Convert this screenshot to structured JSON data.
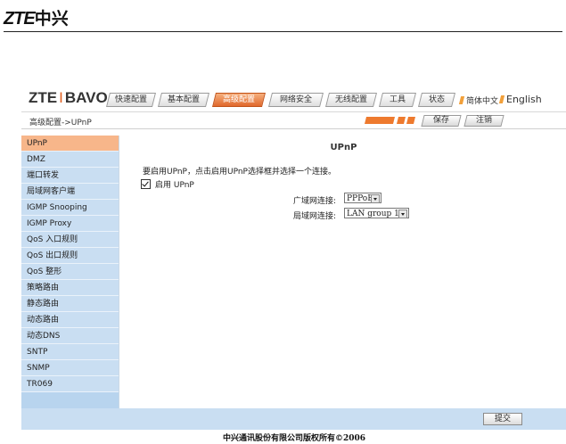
{
  "document": {
    "logo_latin": "ZTE",
    "logo_cjk": "中兴"
  },
  "header": {
    "brand_left": "ZTE",
    "brand_sep": "I",
    "brand_right": "BAVO",
    "tabs": [
      {
        "label": "快速配置",
        "active": false
      },
      {
        "label": "基本配置",
        "active": false
      },
      {
        "label": "高级配置",
        "active": true
      },
      {
        "label": "网络安全",
        "active": false
      },
      {
        "label": "无线配置",
        "active": false
      },
      {
        "label": "工具",
        "active": false
      },
      {
        "label": "状态",
        "active": false
      }
    ],
    "lang_cn": "简体中文",
    "lang_en": "English"
  },
  "subbar": {
    "breadcrumb": "高级配置->UPnP",
    "save_label": "保存",
    "logout_label": "注销"
  },
  "sidebar": {
    "items": [
      {
        "label": "UPnP",
        "active": true
      },
      {
        "label": "DMZ"
      },
      {
        "label": "端口转发"
      },
      {
        "label": "局域网客户端"
      },
      {
        "label": "IGMP Snooping"
      },
      {
        "label": "IGMP Proxy"
      },
      {
        "label": "QoS 入口规则"
      },
      {
        "label": "QoS 出口规则"
      },
      {
        "label": "QoS 整形"
      },
      {
        "label": "策略路由"
      },
      {
        "label": "静态路由"
      },
      {
        "label": "动态路由"
      },
      {
        "label": "动态DNS"
      },
      {
        "label": "SNTP"
      },
      {
        "label": "SNMP"
      },
      {
        "label": "TR069"
      }
    ]
  },
  "main": {
    "title": "UPnP",
    "description": "要启用UPnP，点击启用UPnP选择框并选择一个连接。",
    "enable_label": "启用 UPnP",
    "enable_checked": true,
    "wan_label": "广域网连接:",
    "wan_value": "PPPoE1",
    "lan_label": "局域网连接:",
    "lan_value": "LAN group 1",
    "submit_label": "提交"
  },
  "footer": {
    "copyright": "中兴通讯股份有限公司版权所有©2006"
  },
  "colors": {
    "accent": "#e0682c",
    "sidebar": "#c9def2",
    "sidebar_active": "#f7b68a"
  }
}
